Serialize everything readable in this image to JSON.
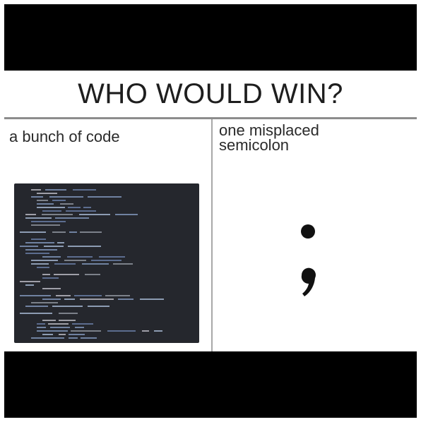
{
  "meme": {
    "title": "WHO WOULD WIN?",
    "left_label": "a bunch of code",
    "right_label_line1": "one misplaced",
    "right_label_line2": "semicolon"
  },
  "icons": {
    "code_image": "code-screenshot",
    "semicolon_glyph": "semicolon-icon"
  },
  "colors": {
    "background_bars": "#000000",
    "panel": "#ffffff",
    "code_bg": "#25272d",
    "text": "#1e1e1e"
  }
}
